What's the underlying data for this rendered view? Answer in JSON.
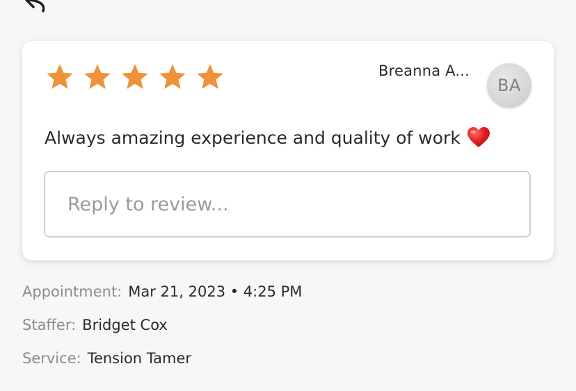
{
  "icons": {
    "back": "back-arrow-icon",
    "star": "star-icon",
    "heart": "heart-icon"
  },
  "colors": {
    "star": "#f0923a",
    "heart": "#e0201f"
  },
  "review": {
    "rating": 5,
    "rating_max": 5,
    "reviewer_name": "Breanna A...",
    "avatar_initials": "BA",
    "text": "Always amazing experience and quality of work",
    "reply_placeholder": "Reply to review..."
  },
  "details": {
    "appointment_label": "Appointment:",
    "appointment_value": "Mar 21, 2023 • 4:25 PM",
    "staffer_label": "Staffer:",
    "staffer_value": "Bridget Cox",
    "service_label": "Service:",
    "service_value": "Tension Tamer"
  }
}
